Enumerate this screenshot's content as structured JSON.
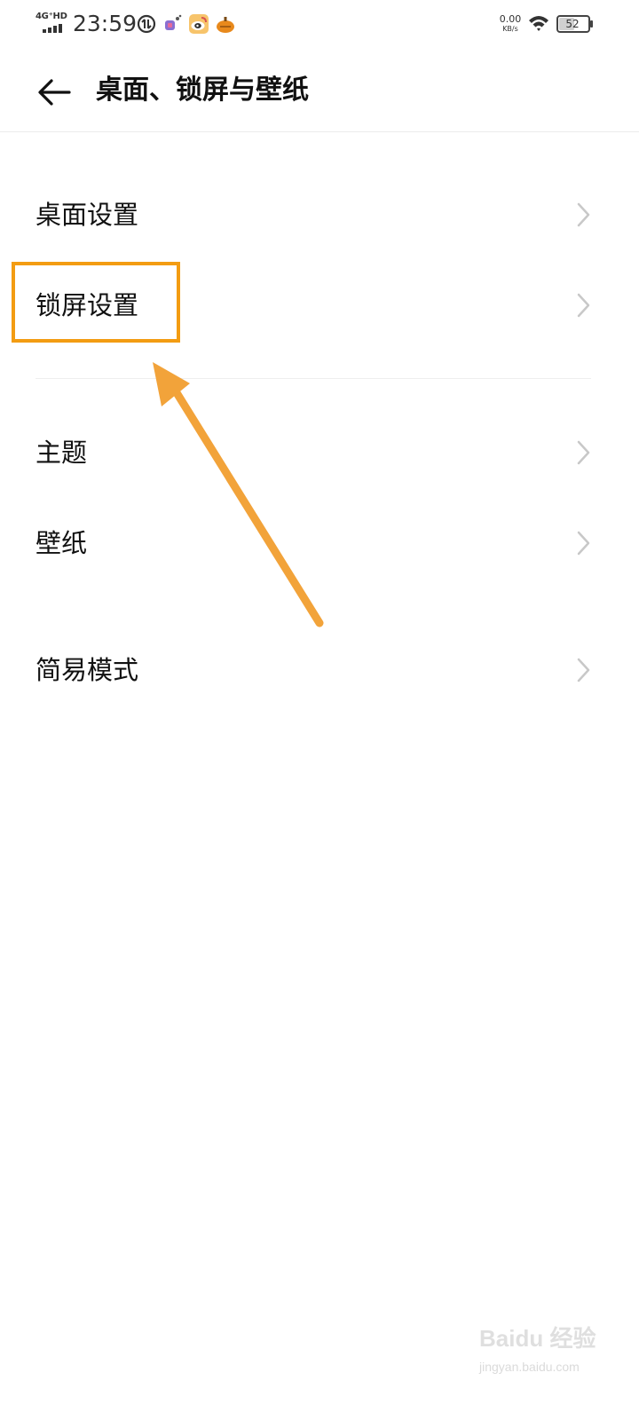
{
  "status_bar": {
    "network_label": "4G⁺HD",
    "time": "23:59",
    "net_speed_value": "0.00",
    "net_speed_unit": "KB/s",
    "battery_level": "52",
    "notification_icons": [
      "data-saver-icon",
      "app-notification-icon",
      "weibo-icon",
      "pumpkin-app-icon"
    ]
  },
  "header": {
    "title": "桌面、锁屏与壁纸",
    "back_icon": "arrow-left-icon"
  },
  "settings": {
    "group1": [
      {
        "label": "桌面设置"
      },
      {
        "label": "锁屏设置"
      }
    ],
    "group2": [
      {
        "label": "主题"
      },
      {
        "label": "壁纸"
      }
    ],
    "group3": [
      {
        "label": "简易模式"
      }
    ]
  },
  "annotation": {
    "color": "#f39c12",
    "target": "锁屏设置"
  },
  "watermark": {
    "logo_text": "Baidu 经验",
    "url": "jingyan.baidu.com"
  },
  "colors": {
    "background": "#ffffff",
    "text": "#111111",
    "chevron": "#c8c8c8",
    "divider": "#eeeeee"
  }
}
